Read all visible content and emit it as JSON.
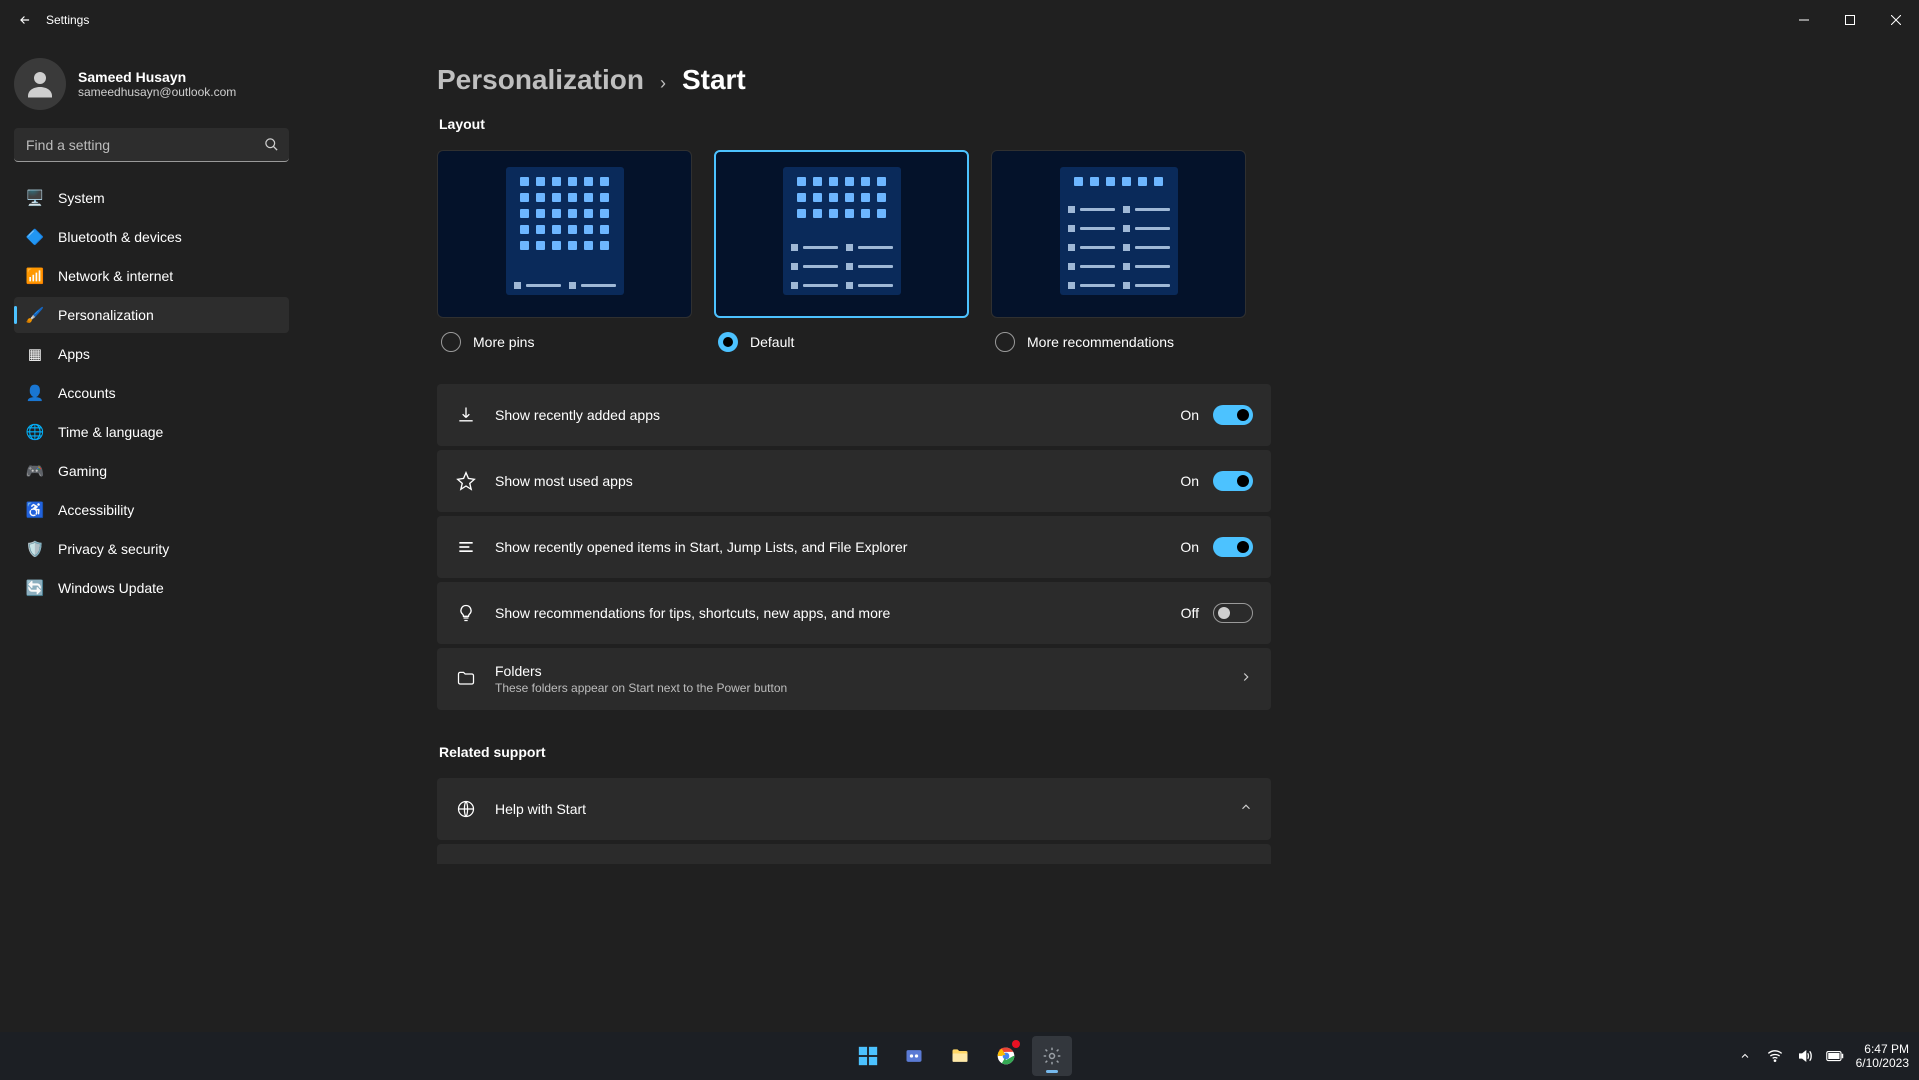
{
  "window": {
    "title": "Settings"
  },
  "profile": {
    "name": "Sameed Husayn",
    "email": "sameedhusayn@outlook.com"
  },
  "search": {
    "placeholder": "Find a setting"
  },
  "nav": {
    "items": [
      {
        "icon": "🖥️",
        "label": "System"
      },
      {
        "icon": "🔷",
        "label": "Bluetooth & devices"
      },
      {
        "icon": "📶",
        "label": "Network & internet"
      },
      {
        "icon": "🖌️",
        "label": "Personalization",
        "active": true
      },
      {
        "icon": "▦",
        "label": "Apps"
      },
      {
        "icon": "👤",
        "label": "Accounts"
      },
      {
        "icon": "🌐",
        "label": "Time & language"
      },
      {
        "icon": "🎮",
        "label": "Gaming"
      },
      {
        "icon": "♿",
        "label": "Accessibility"
      },
      {
        "icon": "🛡️",
        "label": "Privacy & security"
      },
      {
        "icon": "🔄",
        "label": "Windows Update"
      }
    ]
  },
  "breadcrumb": {
    "parent": "Personalization",
    "sep": "›",
    "current": "Start"
  },
  "layout": {
    "heading": "Layout",
    "options": [
      {
        "label": "More pins"
      },
      {
        "label": "Default",
        "selected": true
      },
      {
        "label": "More recommendations"
      }
    ]
  },
  "settings": [
    {
      "icon": "download",
      "label": "Show recently added apps",
      "state": "On",
      "on": true
    },
    {
      "icon": "star",
      "label": "Show most used apps",
      "state": "On",
      "on": true
    },
    {
      "icon": "list",
      "label": "Show recently opened items in Start, Jump Lists, and File Explorer",
      "state": "On",
      "on": true
    },
    {
      "icon": "bulb",
      "label": "Show recommendations for tips, shortcuts, new apps, and more",
      "state": "Off",
      "on": false
    }
  ],
  "folders": {
    "title": "Folders",
    "subtitle": "These folders appear on Start next to the Power button"
  },
  "related": {
    "heading": "Related support",
    "help": "Help with Start"
  },
  "taskbar": {
    "time": "6:47 PM",
    "date": "6/10/2023"
  }
}
